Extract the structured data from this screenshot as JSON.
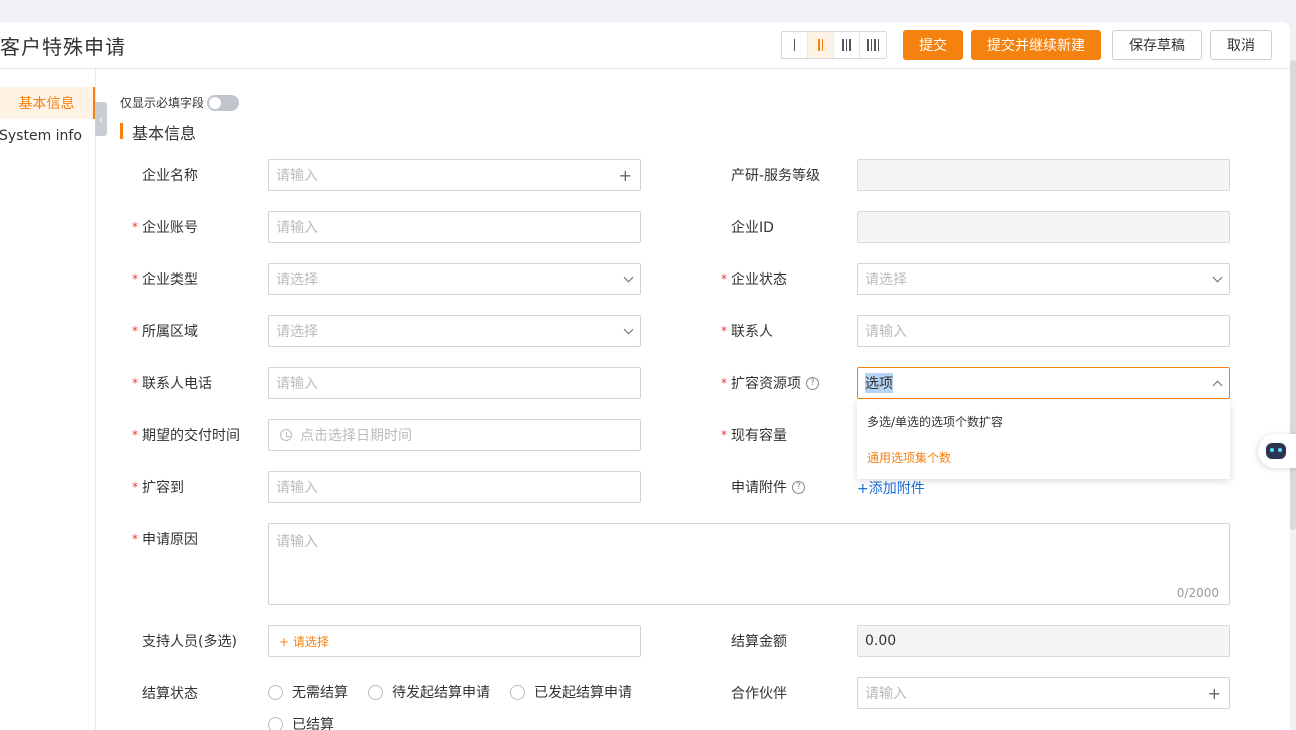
{
  "page": {
    "title": "客户特殊申请",
    "buttons": {
      "submit": "提交",
      "submit_new": "提交并继续新建",
      "save_draft": "保存草稿",
      "cancel": "取消"
    },
    "layout_options": [
      "I",
      "II",
      "III",
      "IIII"
    ],
    "active_layout": "II"
  },
  "sidebar": {
    "items": [
      {
        "label": "基本信息",
        "active": true
      },
      {
        "label": "System info",
        "active": false
      }
    ]
  },
  "form": {
    "toggle_label": "仅显示必填字段",
    "toggle_on": false,
    "section_title": "基本信息",
    "fields": {
      "company_name": {
        "label": "企业名称",
        "required": false,
        "placeholder": "请输入"
      },
      "rd_level": {
        "label": "产研-服务等级",
        "required": false,
        "value": ""
      },
      "company_account": {
        "label": "企业账号",
        "required": true,
        "placeholder": "请输入"
      },
      "company_id": {
        "label": "企业ID",
        "required": false,
        "value": ""
      },
      "company_type": {
        "label": "企业类型",
        "required": true,
        "placeholder": "请选择"
      },
      "company_status": {
        "label": "企业状态",
        "required": true,
        "placeholder": "请选择"
      },
      "region": {
        "label": "所属区域",
        "required": true,
        "placeholder": "请选择"
      },
      "contact": {
        "label": "联系人",
        "required": true,
        "placeholder": "请输入"
      },
      "contact_phone": {
        "label": "联系人电话",
        "required": true,
        "placeholder": "请输入"
      },
      "expand_item": {
        "label": "扩容资源项",
        "required": true,
        "value": "选项"
      },
      "delivery_time": {
        "label": "期望的交付时间",
        "required": true,
        "placeholder": "点击选择日期时间"
      },
      "current_capacity": {
        "label": "现有容量",
        "required": true
      },
      "expand_to": {
        "label": "扩容到",
        "required": true,
        "placeholder": "请输入"
      },
      "attachment": {
        "label": "申请附件",
        "required": false,
        "link": "+添加附件"
      },
      "reason": {
        "label": "申请原因",
        "required": true,
        "placeholder": "请输入",
        "counter": "0/2000"
      },
      "support_staff": {
        "label": "支持人员(多选)",
        "required": false,
        "pick": "+ 请选择"
      },
      "settle_amount": {
        "label": "结算金额",
        "required": false,
        "value": "0.00"
      },
      "settle_status": {
        "label": "结算状态",
        "required": false,
        "options": [
          "无需结算",
          "待发起结算申请",
          "已发起结算申请",
          "已结算"
        ]
      },
      "partner": {
        "label": "合作伙伴",
        "required": false,
        "placeholder": "请输入"
      }
    }
  },
  "dropdown": {
    "options": [
      {
        "label": "多选/单选的选项个数扩容",
        "highlighted": false
      },
      {
        "label": "通用选项集个数",
        "highlighted": true
      }
    ],
    "highlight_color": "#f5810f"
  },
  "colors": {
    "accent": "#f5810f",
    "required": "#e4393c",
    "link": "#1e6fd9"
  },
  "icons": {
    "bot": "robot-assistant-icon"
  }
}
